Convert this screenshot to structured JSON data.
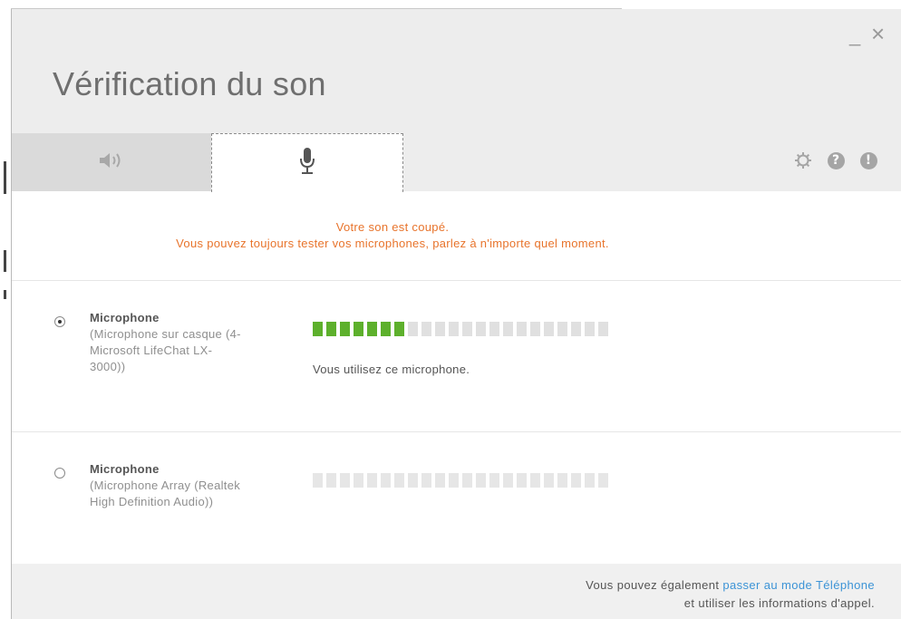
{
  "window": {
    "title": "Vérification du son",
    "minimize_glyph": "_",
    "close_glyph": "×"
  },
  "tabs": [
    {
      "name": "tab-speaker",
      "icon": "speaker-icon",
      "selected": false
    },
    {
      "name": "tab-microphone",
      "icon": "microphone-icon",
      "selected": true
    }
  ],
  "header_icons": [
    "gear-icon",
    "help-icon",
    "alert-icon"
  ],
  "header_glyphs": {
    "help": "?",
    "alert": "!"
  },
  "notice": {
    "line1": "Votre son est coupé.",
    "line2": "Vous pouvez toujours tester vos microphones, parlez à n'importe quel moment."
  },
  "microphones": [
    {
      "name": "Microphone",
      "detail": "(Microphone sur casque (4- Microsoft LifeChat LX-3000))",
      "selected": true,
      "level": 0.32,
      "status": "Vous utilisez ce microphone."
    },
    {
      "name": "Microphone",
      "detail": "(Microphone Array (Realtek High Definition Audio))",
      "selected": false,
      "level": 0,
      "status": ""
    }
  ],
  "meter_segments": 22,
  "footer": {
    "prefix": "Vous pouvez également ",
    "link": "passer au mode Téléphone",
    "line2": "et utiliser les informations d'appel."
  },
  "colors": {
    "notice": "#e8742c",
    "meter_on": "#5db02c",
    "link": "#3c93d6"
  }
}
